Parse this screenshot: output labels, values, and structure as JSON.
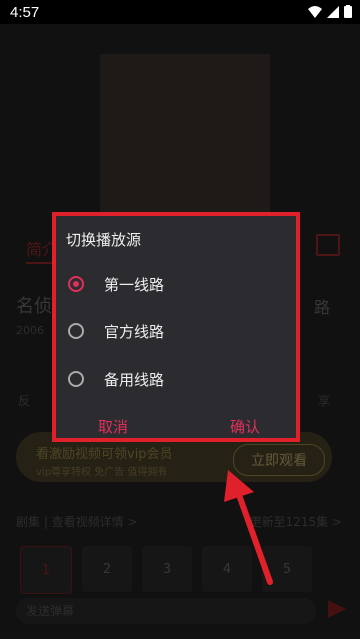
{
  "status_bar": {
    "time": "4:57"
  },
  "background_page": {
    "tab_intro": "简介",
    "title": "名侦",
    "year": "2006",
    "detail_link": "路",
    "feedback_label": "反",
    "share_label": "享",
    "vip_banner": {
      "title": "看激励视频可领vip会员",
      "subtitle": "vip尊享特权 免广告 值得拥有",
      "button": "立即观看"
    },
    "episodes_left": "剧集 | 查看视频详情 >",
    "episodes_right": "更新至1215集 >",
    "episodes": [
      "1",
      "2",
      "3",
      "4",
      "5"
    ],
    "danmu_placeholder": "发送弹幕"
  },
  "dialog": {
    "title": "切换播放源",
    "options": [
      {
        "label": "第一线路",
        "checked": true
      },
      {
        "label": "官方线路",
        "checked": false
      },
      {
        "label": "备用线路",
        "checked": false
      }
    ],
    "cancel": "取消",
    "confirm": "确认"
  },
  "colors": {
    "accent": "#e0305a",
    "highlight_frame": "#e0202a"
  }
}
